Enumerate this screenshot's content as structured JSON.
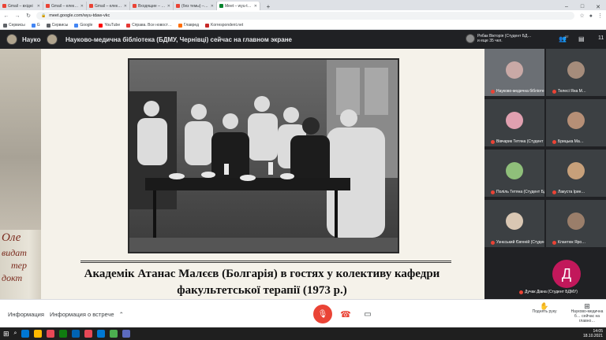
{
  "browser": {
    "tabs": [
      {
        "label": "Gmail – вхідні",
        "color": "#ea4335",
        "active": false
      },
      {
        "label": "Gmail – електронна пошта…",
        "color": "#ea4335",
        "active": false
      },
      {
        "label": "Gmail – електронна пошта з…",
        "color": "#ea4335",
        "active": false
      },
      {
        "label": "Входящие – 11antiplagiat111…",
        "color": "#ea4335",
        "active": false
      },
      {
        "label": "(без темы) – bulat.yul@bsmu.edu…",
        "color": "#ea4335",
        "active": false
      },
      {
        "label": "Meet – wyu-tdaw-vkc",
        "color": "#00832d",
        "active": true
      }
    ],
    "new_tab": "+",
    "window_controls": [
      "–",
      "□",
      "✕"
    ],
    "url": "meet.google.com/wyu-tdaw-vkc",
    "bookmarks": [
      {
        "label": "Сервисы",
        "color": "#5f6368"
      },
      {
        "label": "G",
        "color": "#4285f4"
      },
      {
        "label": "Сервисы",
        "color": "#5f6368"
      },
      {
        "label": "Google",
        "color": "#4285f4"
      },
      {
        "label": "YouTube",
        "color": "#ff0000"
      },
      {
        "label": "Справа. Все новост…",
        "color": "#e53935"
      },
      {
        "label": "Главред",
        "color": "#ff6d00"
      },
      {
        "label": "Korrespondent.net",
        "color": "#c62828"
      }
    ]
  },
  "meet": {
    "title_short": "Науко",
    "title_main": "Науково-медична бібліотека (БДМУ, Чернівці) сейчас на главном экране",
    "presenter": {
      "name": "Рябак Вікторія (Студент БД…",
      "subtitle": "и еще 35 чел."
    },
    "participants_count": "37",
    "more_count": "11",
    "slide": {
      "side_text": [
        "Оле",
        "видат",
        "тер",
        "докт"
      ],
      "caption_line1": "Академік Атанас Малєєв (Болгарія) в гостях у колективу кафедри",
      "caption_line2": "факультетської терапії (1973 р.)"
    },
    "participants": [
      {
        "name": "Науково-медична бібліотека",
        "face": "#c9a9a6"
      },
      {
        "name": "Телесі Яна М…",
        "face": "#a58c7b"
      },
      {
        "name": "Вівчарик Тетяна (Студент БДМУ)",
        "face": "#e0a0b0"
      },
      {
        "name": "Брицька Ма…",
        "face": "#b68f76"
      },
      {
        "name": "Поліль Тетяна (Студент БДМУ)",
        "face": "#8fbf7a"
      },
      {
        "name": "Лакуста Ірин…",
        "face": "#c7a07a"
      },
      {
        "name": "Узнєський Євгеній (Студент Б…",
        "face": "#d9c7b3"
      },
      {
        "name": "Клантюк Яро…",
        "face": "#9a7e6a"
      },
      {
        "name": "Дучак Діана (Студент БДМУ)",
        "face": "#c2185b",
        "letter": "Д"
      }
    ],
    "controls": {
      "info": "Информация",
      "meeting_info": "Информация о встрече",
      "raise_hand": "Поднять руку",
      "presenting": "Науково-медична б… сейчас на главно…"
    },
    "colors": {
      "end_call": "#ea4335",
      "mic_off": "#ea4335",
      "meet_bg": "#202124"
    }
  },
  "taskbar": {
    "apps": [
      "#0078d4",
      "#ffb900",
      "#e74856",
      "#107c10",
      "#0063b1",
      "#e74856",
      "#0078d4",
      "#4caf50",
      "#5c6bc0"
    ],
    "time": "14:05",
    "date": "18.10.2021"
  }
}
